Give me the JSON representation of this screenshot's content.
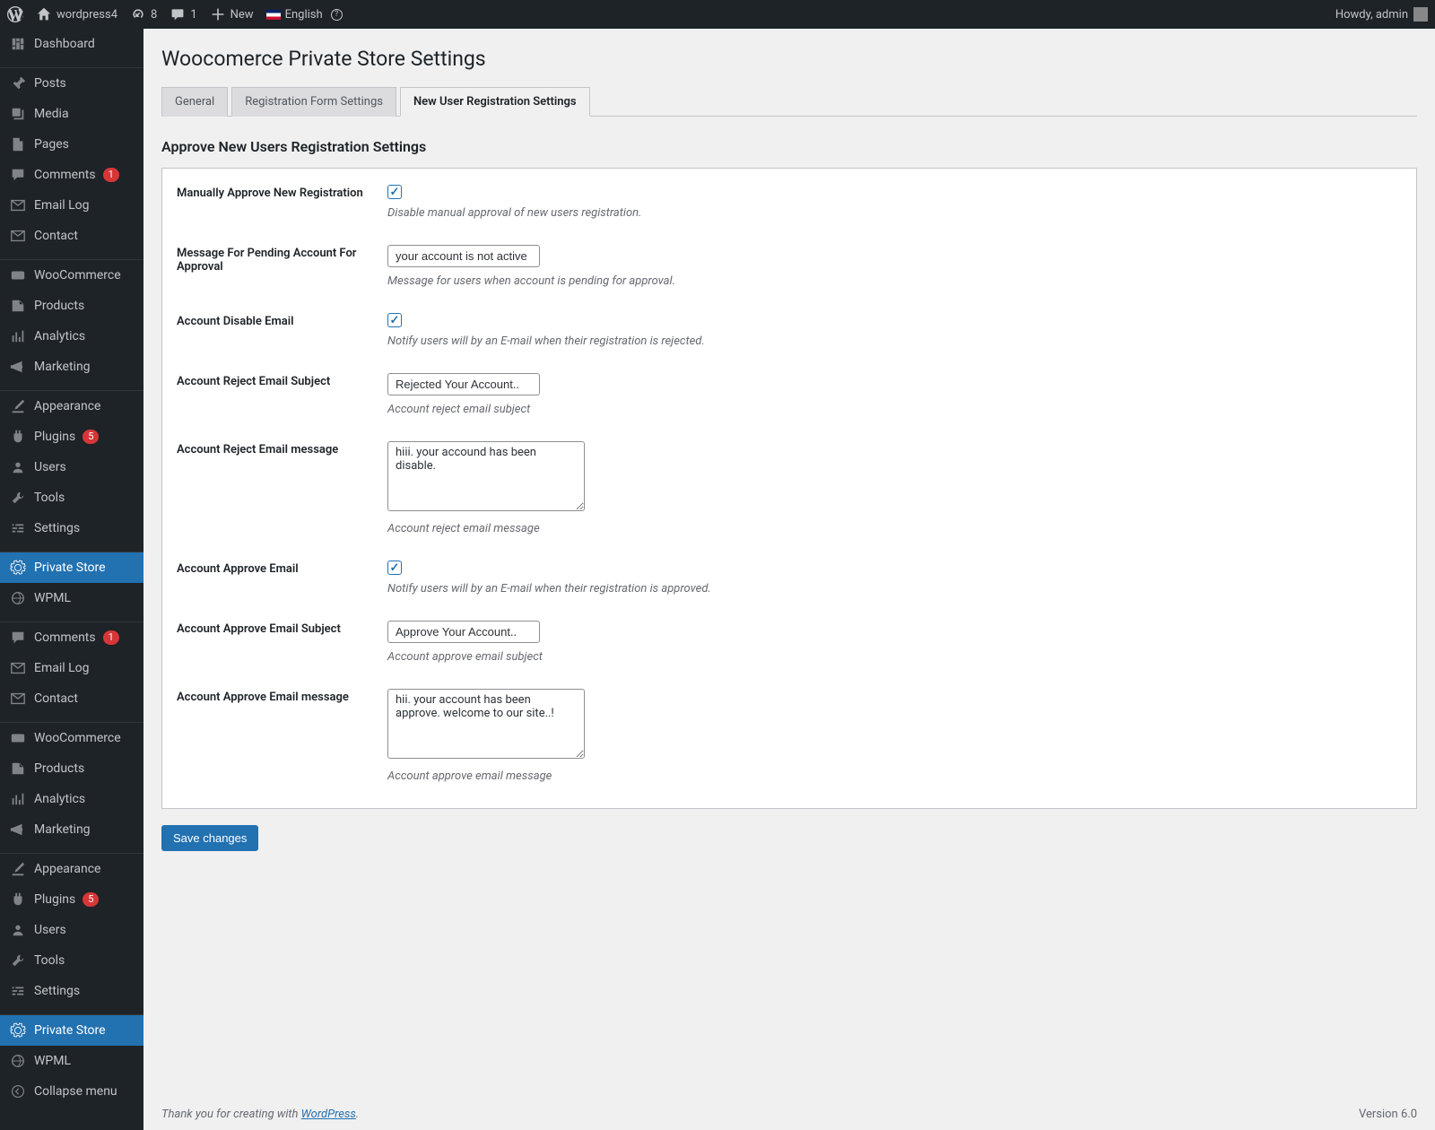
{
  "adminbar": {
    "site_name": "wordpress4",
    "updates_count": "8",
    "comments_count": "1",
    "new_label": "New",
    "language_label": "English",
    "greeting": "Howdy, admin"
  },
  "sidebar": {
    "items": [
      {
        "label": "Dashboard",
        "icon": "dashboard"
      },
      {
        "label": "Posts",
        "icon": "pin"
      },
      {
        "label": "Media",
        "icon": "media"
      },
      {
        "label": "Pages",
        "icon": "pages"
      },
      {
        "label": "Comments",
        "icon": "comment",
        "badge": "1"
      },
      {
        "label": "Email Log",
        "icon": "mail"
      },
      {
        "label": "Contact",
        "icon": "mail"
      },
      {
        "label": "WooCommerce",
        "icon": "woo"
      },
      {
        "label": "Products",
        "icon": "products"
      },
      {
        "label": "Analytics",
        "icon": "analytics"
      },
      {
        "label": "Marketing",
        "icon": "marketing"
      },
      {
        "label": "Appearance",
        "icon": "appearance"
      },
      {
        "label": "Plugins",
        "icon": "plugins",
        "badge": "5"
      },
      {
        "label": "Users",
        "icon": "users"
      },
      {
        "label": "Tools",
        "icon": "tools"
      },
      {
        "label": "Settings",
        "icon": "settings"
      },
      {
        "label": "Private Store",
        "icon": "gear",
        "current": true
      },
      {
        "label": "WPML",
        "icon": "wpml"
      },
      {
        "label": "Comments",
        "icon": "comment",
        "badge": "1"
      },
      {
        "label": "Email Log",
        "icon": "mail"
      },
      {
        "label": "Contact",
        "icon": "mail"
      },
      {
        "label": "WooCommerce",
        "icon": "woo"
      },
      {
        "label": "Products",
        "icon": "products"
      },
      {
        "label": "Analytics",
        "icon": "analytics"
      },
      {
        "label": "Marketing",
        "icon": "marketing"
      },
      {
        "label": "Appearance",
        "icon": "appearance"
      },
      {
        "label": "Plugins",
        "icon": "plugins",
        "badge": "5"
      },
      {
        "label": "Users",
        "icon": "users"
      },
      {
        "label": "Tools",
        "icon": "tools"
      },
      {
        "label": "Settings",
        "icon": "settings"
      },
      {
        "label": "Private Store",
        "icon": "gear",
        "current": true
      },
      {
        "label": "WPML",
        "icon": "wpml"
      }
    ],
    "collapse_label": "Collapse menu"
  },
  "page": {
    "title": "Woocomerce Private Store Settings",
    "tabs": [
      "General",
      "Registration Form Settings",
      "New User Registration Settings"
    ],
    "section_title": "Approve New Users Registration Settings",
    "fields": {
      "manual_approve": {
        "label": "Manually Approve New Registration",
        "help": "Disable manual approval of new users registration.",
        "checked": true
      },
      "pending_msg": {
        "label": "Message For Pending Account For Approval",
        "value": "your account is not active",
        "help": "Message for users when account is pending for approval."
      },
      "disable_email": {
        "label": "Account Disable Email",
        "help": "Notify users will by an E-mail when their registration is rejected.",
        "checked": true
      },
      "reject_subject": {
        "label": "Account Reject Email Subject",
        "value": "Rejected Your Account..",
        "help": "Account reject email subject"
      },
      "reject_msg": {
        "label": "Account Reject Email message",
        "value": "hiii. your accound has been disable.",
        "help": "Account reject email message"
      },
      "approve_email": {
        "label": "Account Approve Email",
        "help": "Notify users will by an E-mail when their registration is approved.",
        "checked": true
      },
      "approve_subject": {
        "label": "Account Approve Email Subject",
        "value": "Approve Your Account..",
        "help": "Account approve email subject"
      },
      "approve_msg": {
        "label": "Account Approve Email message",
        "value": "hii. your account has been approve. welcome to our site..!",
        "help": "Account approve email message"
      }
    },
    "save_button": "Save changes"
  },
  "footer": {
    "thank_prefix": "Thank you for creating with ",
    "thank_link": "WordPress",
    "thank_suffix": ".",
    "version": "Version 6.0"
  }
}
